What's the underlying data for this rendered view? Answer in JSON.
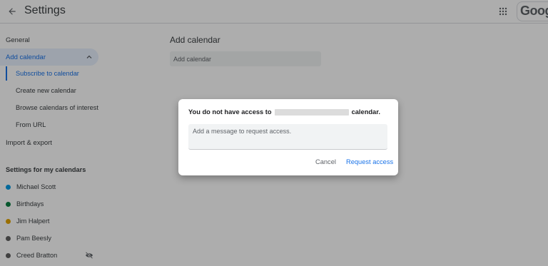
{
  "header": {
    "title": "Settings",
    "back_icon": "arrow-back-icon",
    "apps_icon": "apps-grid-icon",
    "logo_text": "Google"
  },
  "sidebar": {
    "general": "General",
    "add_calendar": "Add calendar",
    "sub_items": [
      "Subscribe to calendar",
      "Create new calendar",
      "Browse calendars of interest",
      "From URL"
    ],
    "import_export": "Import & export",
    "my_calendars_title": "Settings for my calendars",
    "calendars": [
      {
        "name": "Michael Scott",
        "color": "#039be5"
      },
      {
        "name": "Birthdays",
        "color": "#0b8043"
      },
      {
        "name": "Jim Halpert",
        "color": "#e4a400"
      },
      {
        "name": "Pam Beesly",
        "color": "#616161"
      },
      {
        "name": "Creed Bratton",
        "color": "#616161"
      }
    ]
  },
  "main": {
    "section_title": "Add calendar",
    "input_placeholder": "Add calendar"
  },
  "dialog": {
    "message_prefix": "You do not have access to",
    "message_suffix": "calendar.",
    "textarea_placeholder": "Add a message to request access.",
    "cancel_label": "Cancel",
    "request_label": "Request access"
  },
  "colors": {
    "accent": "#1a73e8",
    "active_bg": "#e8f0fe"
  }
}
